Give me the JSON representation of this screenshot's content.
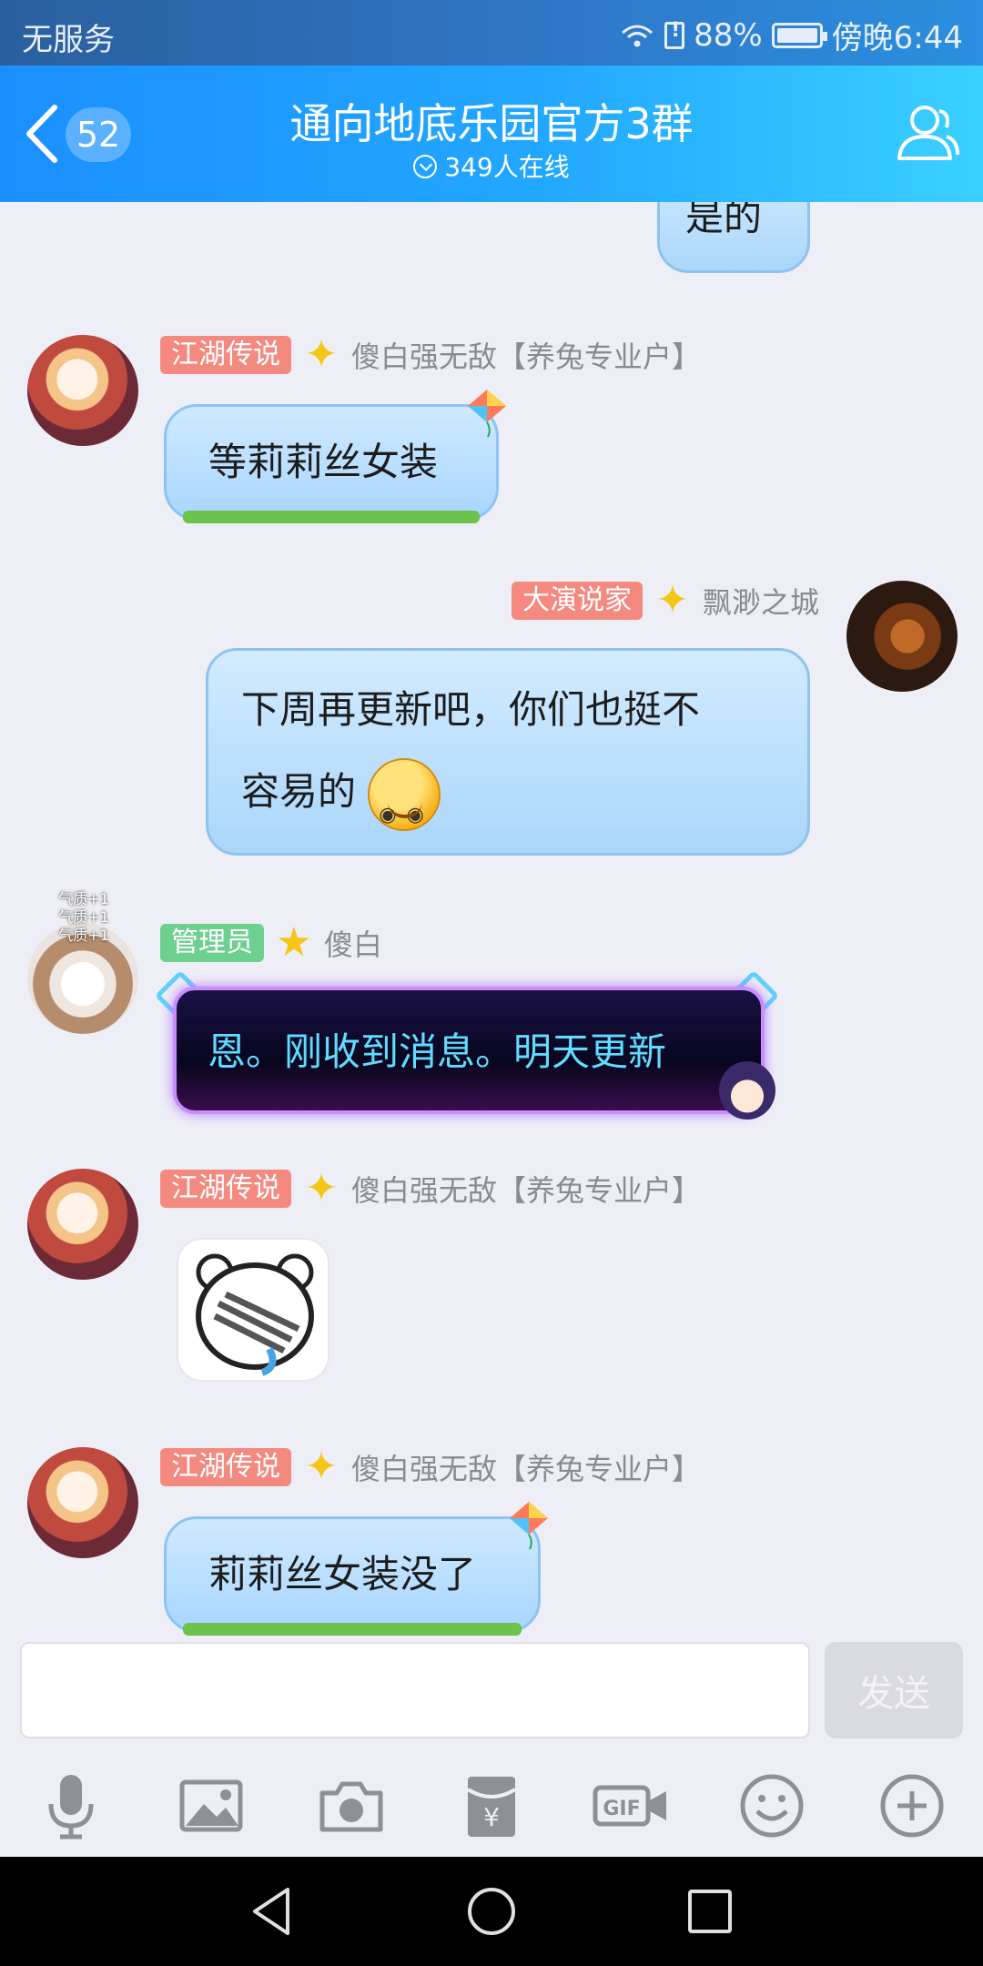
{
  "status_bar": {
    "carrier": "无服务",
    "battery": "88%",
    "battery_level": 0.88,
    "time": "傍晚6:44"
  },
  "header": {
    "unread_count": "52",
    "title": "通向地底乐园官方3群",
    "online": "349人在线"
  },
  "messages": [
    {
      "side": "right",
      "text": "是的"
    },
    {
      "side": "left",
      "badge": "江湖传说",
      "sender": "傻白强无敌【养兔专业户】",
      "text": "等莉莉丝女装"
    },
    {
      "side": "right",
      "badge": "大演说家",
      "sender": "飘渺之城",
      "line1": "下周再更新吧，你们也挺不",
      "line2": "容易的"
    },
    {
      "side": "left",
      "badge": "管理员",
      "sender": "傻白",
      "text": "恩。刚收到消息。明天更新",
      "avatar_overlay": [
        "气质+1",
        "气质+1",
        "气质+1"
      ]
    },
    {
      "side": "left",
      "badge": "江湖传说",
      "sender": "傻白强无敌【养兔专业户】",
      "sticker": "bear-facepalm-icon"
    },
    {
      "side": "left",
      "badge": "江湖传说",
      "sender": "傻白强无敌【养兔专业户】",
      "text": "莉莉丝女装没了"
    }
  ],
  "input": {
    "value": "",
    "send_label": "发送"
  },
  "toolbar": [
    "microphone-icon",
    "image-icon",
    "camera-icon",
    "red-packet-icon",
    "gif-icon",
    "emoji-icon",
    "plus-icon"
  ],
  "colors": {
    "header_start": "#1b8fff",
    "header_end": "#3ad0ff",
    "badge_red": "#f48a7f",
    "badge_green": "#6dd08f",
    "bubble_blue": "#aad6fa"
  }
}
